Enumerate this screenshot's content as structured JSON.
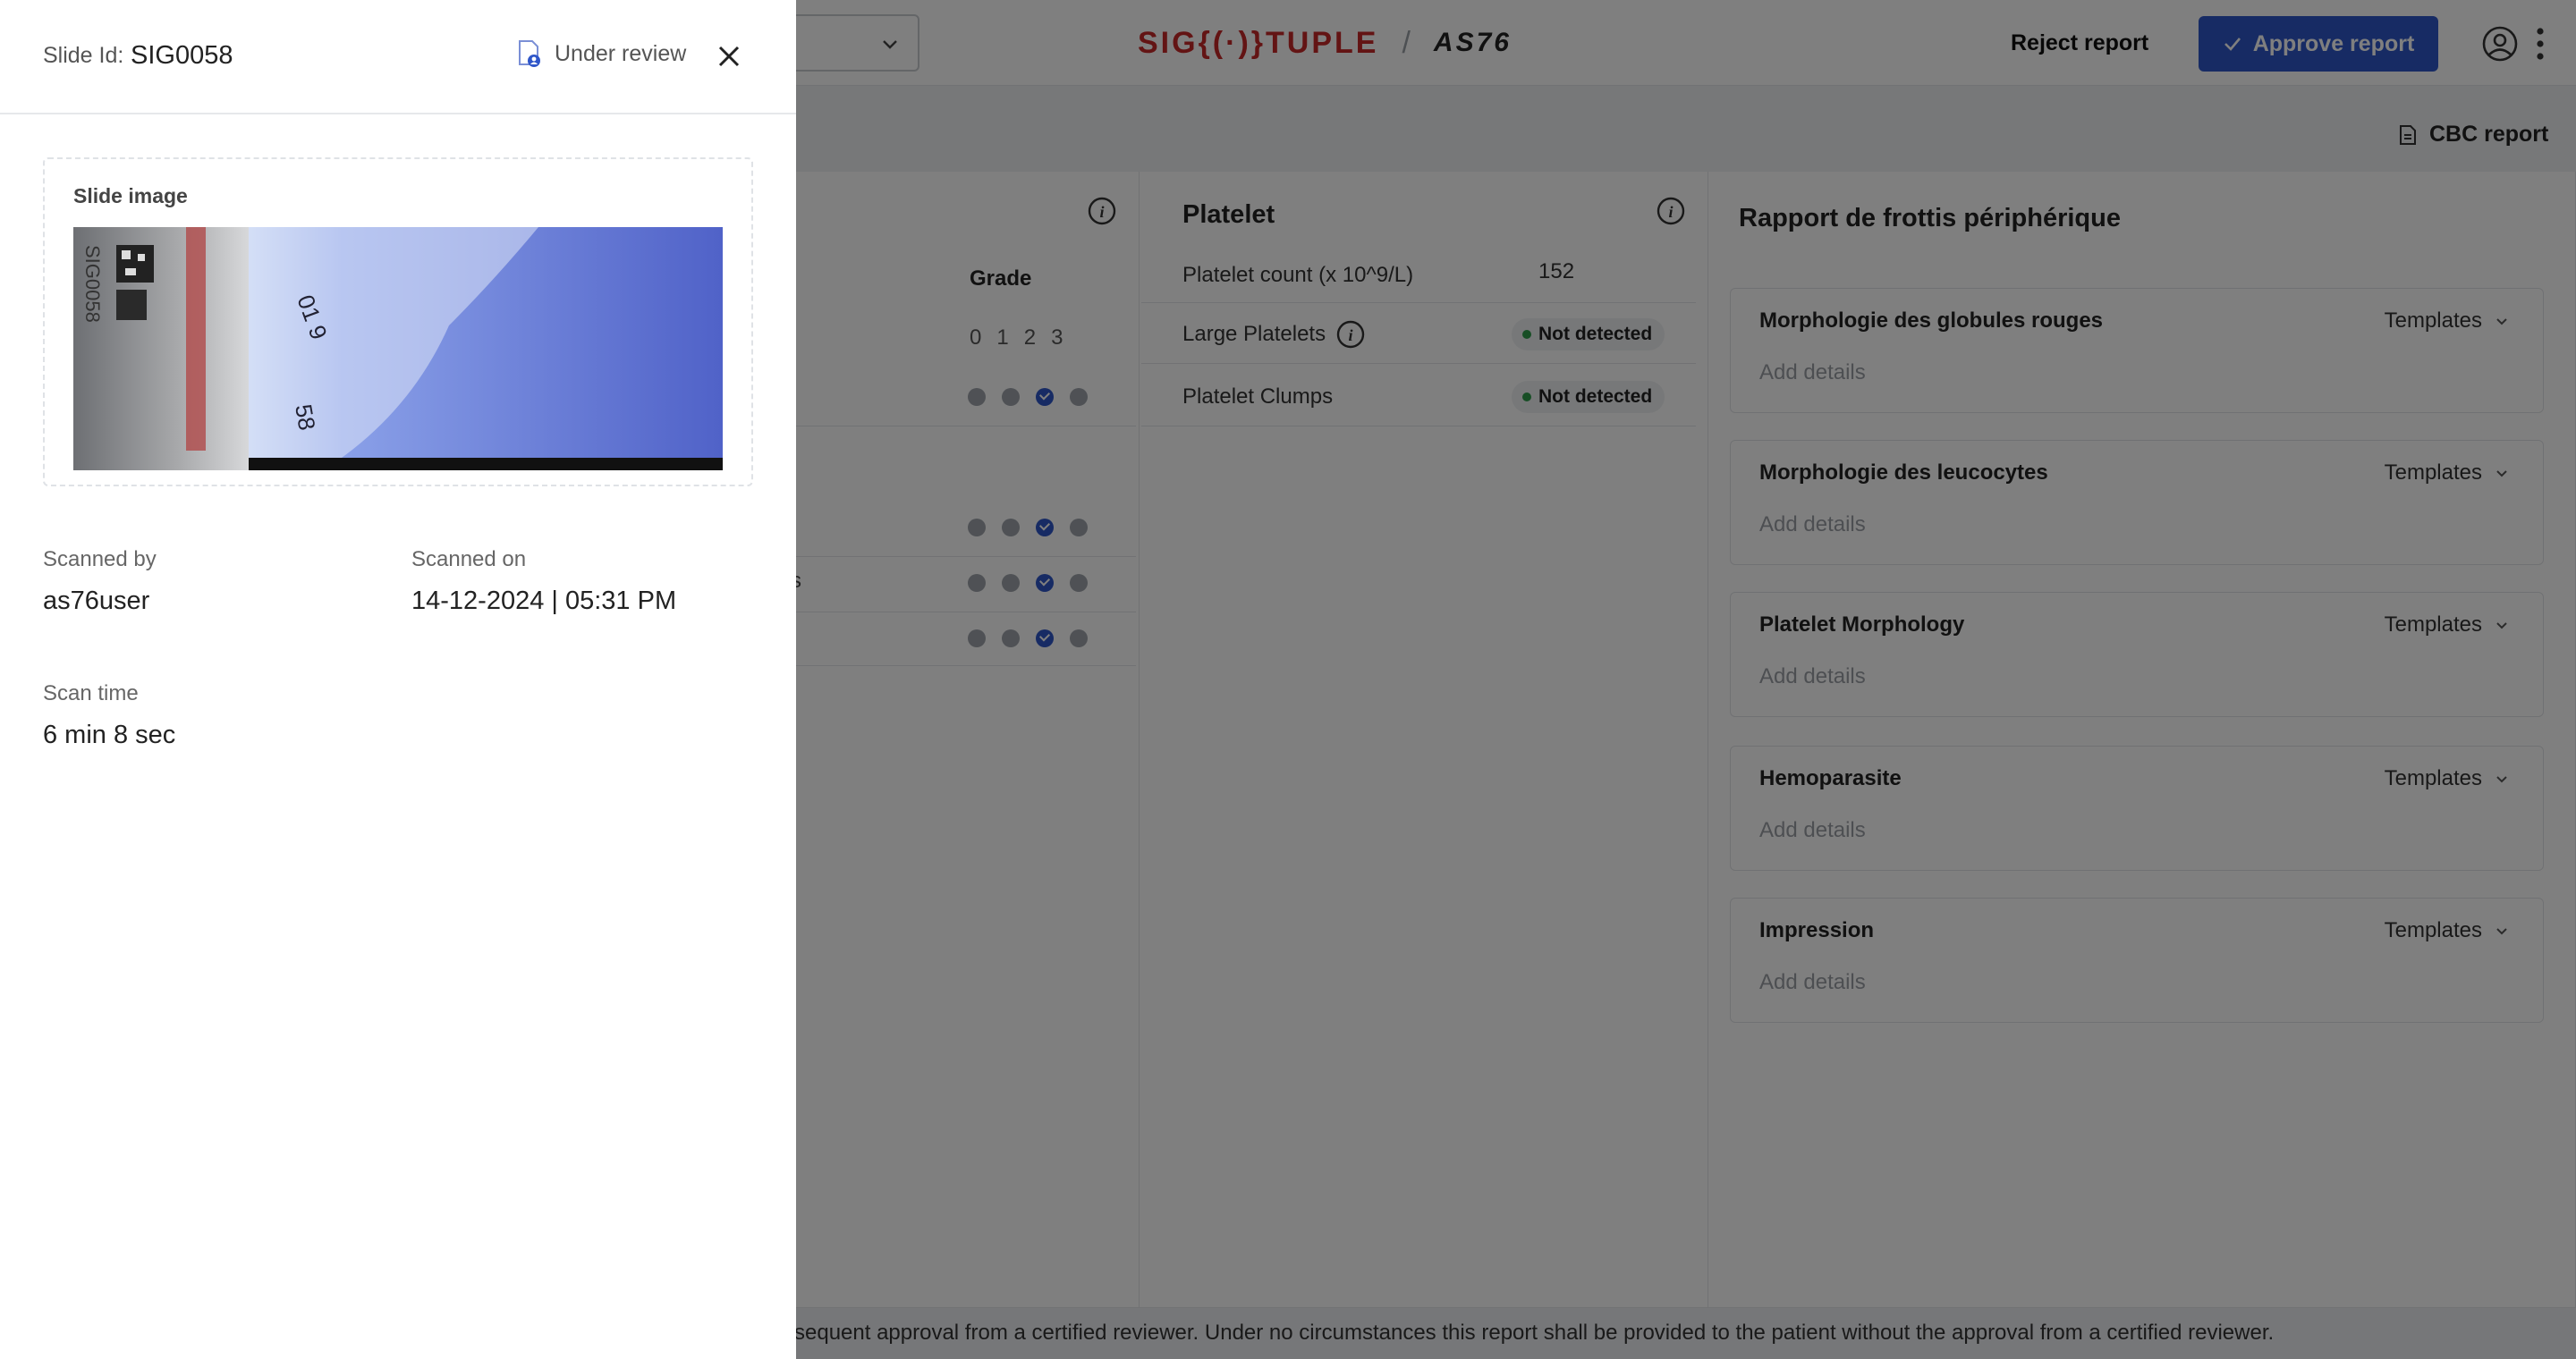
{
  "topbar": {
    "logo_brand": "SIG{(·)}TUPLE",
    "logo_sep": "/",
    "logo_model": "AS76",
    "reject_label": "Reject report",
    "approve_label": "Approve report"
  },
  "subbar": {
    "cbc_label": "CBC report"
  },
  "grades": {
    "header": "Grade",
    "scale": [
      "0",
      "1",
      "2",
      "3"
    ],
    "partial_label": "s"
  },
  "platelet": {
    "title": "Platelet",
    "count_label": "Platelet count (x 10^9/L)",
    "count_value": "152",
    "rows": [
      {
        "label": "Large Platelets",
        "status": "Not detected"
      },
      {
        "label": "Platelet Clumps",
        "status": "Not detected"
      }
    ]
  },
  "rapport": {
    "title": "Rapport de frottis périphérique",
    "sections": [
      {
        "title": "Morphologie des globules rouges",
        "templates": "Templates",
        "placeholder": "Add details"
      },
      {
        "title": "Morphologie des leucocytes",
        "templates": "Templates",
        "placeholder": "Add details"
      },
      {
        "title": "Platelet Morphology",
        "templates": "Templates",
        "placeholder": "Add details"
      },
      {
        "title": "Hemoparasite",
        "templates": "Templates",
        "placeholder": "Add details"
      },
      {
        "title": "Impression",
        "templates": "Templates",
        "placeholder": "Add details"
      }
    ]
  },
  "footer": {
    "text": "sequent approval from a certified reviewer. Under no circumstances this report shall be provided to the patient without the approval from a certified reviewer."
  },
  "drawer": {
    "slide_id_label": "Slide Id:",
    "slide_id": "SIG0058",
    "status": "Under review",
    "image_title": "Slide image",
    "label_slide_text": "SIG0058",
    "scanned_by_label": "Scanned by",
    "scanned_by": "as76user",
    "scanned_on_label": "Scanned on",
    "scanned_on": "14-12-2024 | 05:31 PM",
    "scan_time_label": "Scan time",
    "scan_time": "6 min 8 sec"
  },
  "colors": {
    "primary": "#2f56c9",
    "brand": "#c62828",
    "success": "#2e9d4a"
  }
}
